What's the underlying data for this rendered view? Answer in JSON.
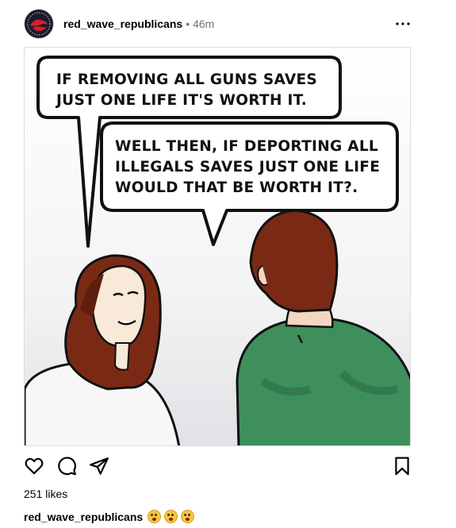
{
  "post": {
    "username": "red_wave_republicans",
    "separator": "•",
    "time": "46m",
    "likes": "251 likes",
    "caption_user": "red_wave_republicans",
    "caption_emojis": [
      "flushed-face-emoji",
      "flushed-face-emoji",
      "flushed-face-emoji"
    ]
  },
  "comic": {
    "bubble1": [
      "IF REMOVING ALL GUNS SAVES",
      "JUST ONE LIFE IT'S WORTH IT."
    ],
    "bubble2": [
      "WELL THEN, IF DEPORTING ALL",
      "ILLEGALS SAVES JUST ONE LIFE",
      "WOULD THAT BE WORTH IT?."
    ]
  },
  "icons": {
    "more": "more-options-icon",
    "like": "heart-icon",
    "comment": "comment-icon",
    "share": "share-icon",
    "save": "bookmark-icon"
  },
  "colors": {
    "meta_gray": "#737373",
    "shirt_green": "#3f8f5c",
    "hair_brown": "#7a2a14"
  }
}
